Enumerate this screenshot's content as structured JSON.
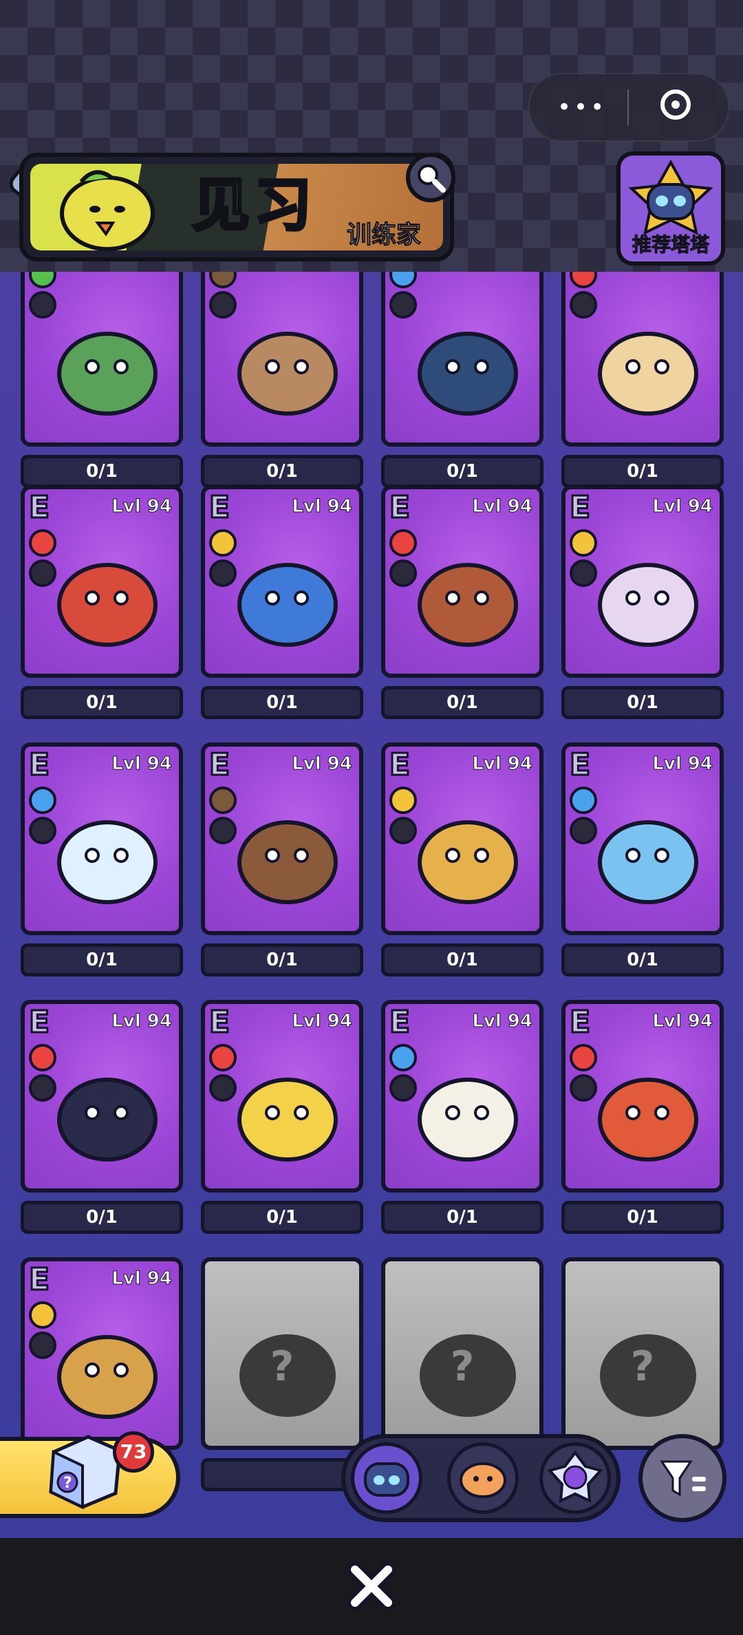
{
  "header": {
    "banner_title": "见习",
    "banner_subtitle": "训练家",
    "recommend_label": "推荐塔塔"
  },
  "cards": [
    {
      "row": 0,
      "col": 0,
      "level": "",
      "count": "0/1",
      "element": "grass",
      "role": "shield"
    },
    {
      "row": 0,
      "col": 1,
      "level": "",
      "count": "0/1",
      "element": "earth",
      "role": "sword"
    },
    {
      "row": 0,
      "col": 2,
      "level": "",
      "count": "0/1",
      "element": "water",
      "role": "shield"
    },
    {
      "row": 0,
      "col": 3,
      "level": "",
      "count": "0/1",
      "element": "fire",
      "role": "heal"
    },
    {
      "row": 1,
      "col": 0,
      "level": "Lvl 94",
      "count": "0/1",
      "element": "fire",
      "role": "sword"
    },
    {
      "row": 1,
      "col": 1,
      "level": "Lvl 94",
      "count": "0/1",
      "element": "electric",
      "role": "shield"
    },
    {
      "row": 1,
      "col": 2,
      "level": "Lvl 94",
      "count": "0/1",
      "element": "fire",
      "role": "heal"
    },
    {
      "row": 1,
      "col": 3,
      "level": "Lvl 94",
      "count": "0/1",
      "element": "electric",
      "role": "potion"
    },
    {
      "row": 2,
      "col": 0,
      "level": "Lvl 94",
      "count": "0/1",
      "element": "water",
      "role": "sword"
    },
    {
      "row": 2,
      "col": 1,
      "level": "Lvl 94",
      "count": "0/1",
      "element": "earth",
      "role": "sword"
    },
    {
      "row": 2,
      "col": 2,
      "level": "Lvl 94",
      "count": "0/1",
      "element": "electric",
      "role": "sword"
    },
    {
      "row": 2,
      "col": 3,
      "level": "Lvl 94",
      "count": "0/1",
      "element": "water",
      "role": "sword"
    },
    {
      "row": 3,
      "col": 0,
      "level": "Lvl 94",
      "count": "0/1",
      "element": "fire",
      "role": "sword"
    },
    {
      "row": 3,
      "col": 1,
      "level": "Lvl 94",
      "count": "0/1",
      "element": "fire",
      "role": "shield"
    },
    {
      "row": 3,
      "col": 2,
      "level": "Lvl 94",
      "count": "0/1",
      "element": "water",
      "role": "shield"
    },
    {
      "row": 3,
      "col": 3,
      "level": "Lvl 94",
      "count": "0/1",
      "element": "fire",
      "role": "sword"
    },
    {
      "row": 4,
      "col": 0,
      "level": "Lvl 94",
      "count": "",
      "element": "electric",
      "role": "sword"
    }
  ],
  "locked_cards": [
    "?",
    "?",
    "?"
  ],
  "gacha": {
    "count": "73"
  },
  "colors": {
    "fire": "#e9443f",
    "water": "#4aa2ef",
    "electric": "#f3c43a",
    "earth": "#7a5a3a",
    "grass": "#55c14d"
  },
  "icons": {
    "menu": "more-dots-icon",
    "record": "record-icon",
    "search": "search-icon",
    "filter": "filter-icon",
    "close": "close-icon"
  }
}
